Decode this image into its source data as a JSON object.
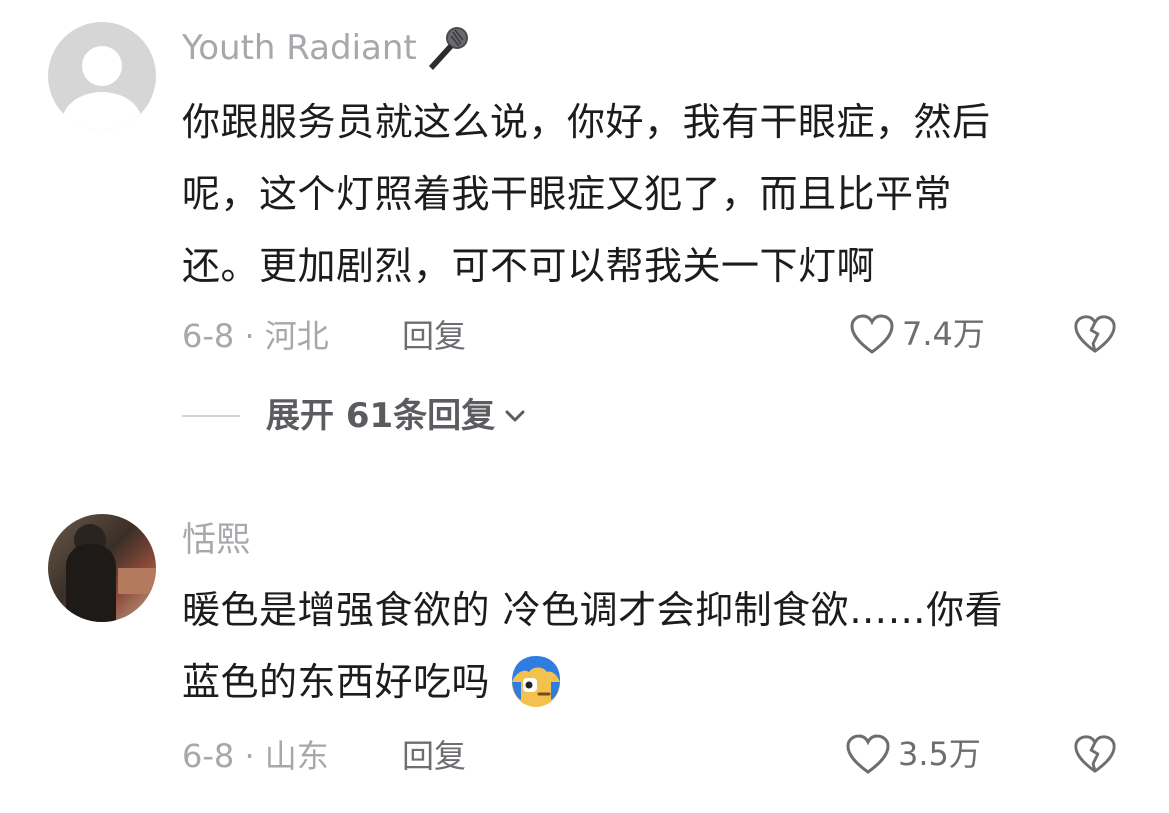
{
  "comments": [
    {
      "username": "Youth Radiant",
      "username_icon": "microphone-icon",
      "avatar": "default-avatar",
      "text_lines": [
        "你跟服务员就这么说，你好，我有干眼症，然后",
        "呢，这个灯照着我干眼症又犯了，而且比平常",
        "还。更加剧烈，可不可以帮我关一下灯啊"
      ],
      "date_location": "6-8 · 河北",
      "reply_label": "回复",
      "likes": "7.4万",
      "expand_replies": "展开 61条回复"
    },
    {
      "username": "恬熙",
      "avatar": "photo-avatar",
      "text_lines": [
        "暖色是增强食欲的 冷色调才会抑制食欲……你看",
        "蓝色的东西好吃吗"
      ],
      "text_emoji": "blue-hair-emoji-icon",
      "date_location": "6-8 · 山东",
      "reply_label": "回复",
      "likes": "3.5万"
    }
  ],
  "colors": {
    "primary_text": "#1c1c1e",
    "secondary_text": "#a7a7ac",
    "action_text": "#6d6d72",
    "divider": "#d4d4d6"
  }
}
